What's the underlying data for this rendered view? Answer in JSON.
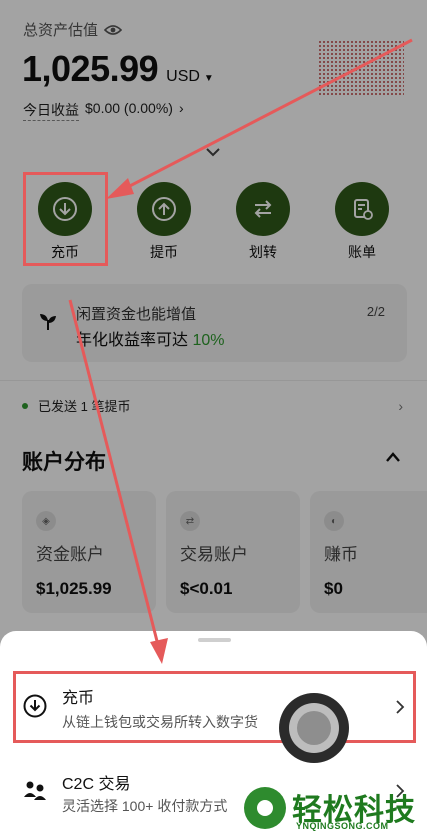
{
  "header": {
    "total_label": "总资产估值",
    "total_amount": "1,025.99",
    "currency": "USD",
    "today_label": "今日收益",
    "today_value": "$0.00 (0.00%)"
  },
  "actions": [
    {
      "label": "充币",
      "icon": "download-icon"
    },
    {
      "label": "提币",
      "icon": "upload-icon"
    },
    {
      "label": "划转",
      "icon": "transfer-icon"
    },
    {
      "label": "账单",
      "icon": "bill-icon"
    }
  ],
  "promo": {
    "title": "闲置资金也能增值",
    "subtitle_prefix": "年化收益率可达 ",
    "subtitle_rate": "10%",
    "page": "2/2"
  },
  "notice": {
    "text": "已发送 1 笔提币"
  },
  "distribution": {
    "title": "账户分布",
    "cards": [
      {
        "name": "资金账户",
        "value": "$1,025.99"
      },
      {
        "name": "交易账户",
        "value": "$<0.01"
      },
      {
        "name": "赚币",
        "value": "$0"
      }
    ]
  },
  "sheet": {
    "options": [
      {
        "title": "充币",
        "subtitle": "从链上钱包或交易所转入数字货"
      },
      {
        "title": "C2C 交易",
        "subtitle": "灵活选择 100+ 收付款方式"
      }
    ]
  },
  "watermark": {
    "cn": "轻松科技",
    "en": "YNQINGSONG.COM"
  },
  "colors": {
    "accent_green": "#2f5a1a",
    "highlight_red": "#e55a5a",
    "positive_green": "#2f9a2f"
  }
}
